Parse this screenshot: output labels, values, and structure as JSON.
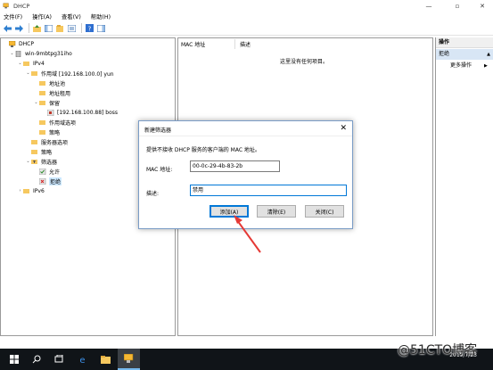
{
  "window": {
    "title": "DHCP",
    "controls": [
      "minimize-icon",
      "maximize-icon",
      "close-icon"
    ]
  },
  "menu": [
    "文件(F)",
    "操作(A)",
    "查看(V)",
    "帮助(H)"
  ],
  "toolbar": [
    "back-icon",
    "forward-icon",
    "up-icon",
    "show-tree-icon",
    "refresh-icon",
    "export-icon",
    "help-icon",
    "view-icon"
  ],
  "tree": {
    "root": "DHCP",
    "server": "win-9mbtpg31iho",
    "ipv4": "IPv4",
    "scope": "作用域 [192.168.100.0] yun",
    "address_pool": "地址池",
    "address_leases": "地址租用",
    "reservations": "保留",
    "reservation_entry": "[192.168.100.88] boss",
    "scope_options": "作用域选项",
    "policies_scope": "策略",
    "server_options": "服务器选项",
    "policies": "策略",
    "filters": "筛选器",
    "allow": "允许",
    "deny": "拒绝",
    "ipv6": "IPv6"
  },
  "list": {
    "columns": [
      "MAC 地址",
      "描述"
    ],
    "empty_message": "这里没有任何项目。"
  },
  "actions": {
    "header": "操作",
    "section": "拒绝",
    "more": "更多操作"
  },
  "dialog": {
    "title": "新建筛选器",
    "description": "提供不接收 DHCP 服务的客户端的 MAC 地址。",
    "mac_label": "MAC 地址:",
    "mac_value": "00-0c-29-4b-83-2b",
    "desc_label": "描述:",
    "desc_value": "禁用",
    "add_button": "添加(A)",
    "clear_button": "清除(E)",
    "close_button": "关闭(C)"
  },
  "colors": {
    "selection": "#cce8ff",
    "accent": "#0078d7",
    "annotation": "#e53935",
    "taskbar": "#101418"
  },
  "taskbar": {
    "items": [
      "start-icon",
      "search-icon",
      "task-view-icon",
      "edge-icon",
      "file-explorer-icon",
      "dhcp-app-icon"
    ],
    "date": "2019/7/23"
  },
  "watermark": {
    "brand": "@51CTO",
    "suffix": "博客"
  }
}
